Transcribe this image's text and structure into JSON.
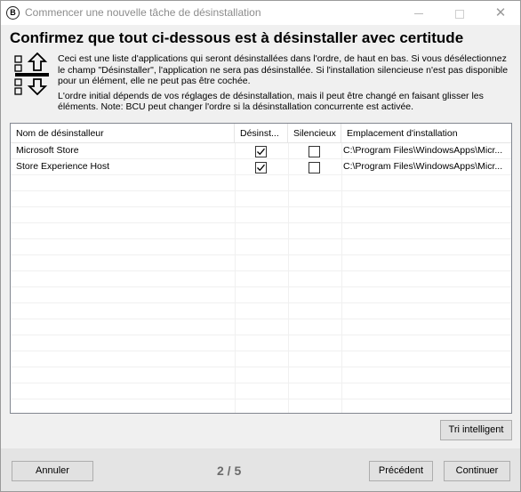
{
  "window": {
    "title": "Commencer une nouvelle tâche de désinstallation",
    "app_icon_letter": "B"
  },
  "heading": "Confirmez que tout ci-dessous est à désinstaller avec certitude",
  "description": {
    "paragraph1": "Ceci est une liste d'applications qui seront désinstallées dans l'ordre, de haut en bas. Si vous désélectionnez le champ \"Désinstaller\", l'application ne sera pas désinstallée. Si l'installation silencieuse n'est pas disponible pour un élément, elle ne peut pas être cochée.",
    "paragraph2": "L'ordre initial dépends de vos réglages de désinstallation, mais il peut être changé en faisant glisser les éléments. Note: BCU peut changer l'ordre si la désinstallation concurrente est activée."
  },
  "list": {
    "columns": [
      "Nom de désinstalleur",
      "Désinst...",
      "Silencieux",
      "Emplacement d'installation"
    ],
    "rows": [
      {
        "name": "Microsoft Store",
        "uninstall": true,
        "silent": false,
        "location": "C:\\Program Files\\WindowsApps\\Micr..."
      },
      {
        "name": "Store Experience Host",
        "uninstall": true,
        "silent": false,
        "location": "C:\\Program Files\\WindowsApps\\Micr..."
      }
    ]
  },
  "buttons": {
    "smart_sort": "Tri intelligent",
    "cancel": "Annuler",
    "previous": "Précédent",
    "continue": "Continuer"
  },
  "page_indicator": "2 / 5"
}
